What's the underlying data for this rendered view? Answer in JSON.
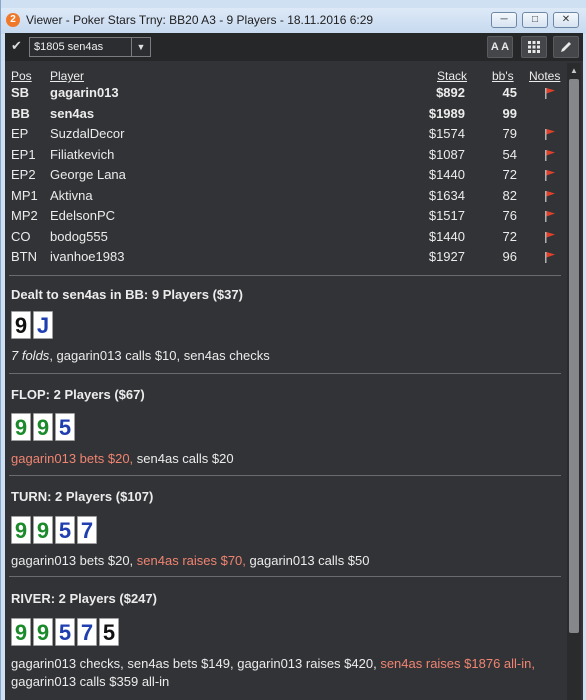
{
  "window": {
    "title": "Viewer - Poker Stars Trny: BB20 A3 - 9 Players - 18.11.2016 6:29",
    "app_icon_label": "2"
  },
  "toolbar": {
    "player_select": "$1805 sen4as",
    "font_button_label": "A A"
  },
  "table": {
    "headers": {
      "pos": "Pos",
      "player": "Player",
      "stack": "Stack",
      "bbs": "bb's",
      "notes": "Notes"
    },
    "rows": [
      {
        "pos": "SB",
        "player": "gagarin013",
        "stack": "$892",
        "bbs": "45",
        "bold": true,
        "flag": true
      },
      {
        "pos": "BB",
        "player": "sen4as",
        "stack": "$1989",
        "bbs": "99",
        "bold": true,
        "flag": false
      },
      {
        "pos": "EP",
        "player": "SuzdalDecor",
        "stack": "$1574",
        "bbs": "79",
        "bold": false,
        "flag": true
      },
      {
        "pos": "EP1",
        "player": "Filiatkevich",
        "stack": "$1087",
        "bbs": "54",
        "bold": false,
        "flag": true
      },
      {
        "pos": "EP2",
        "player": "George Lana",
        "stack": "$1440",
        "bbs": "72",
        "bold": false,
        "flag": true
      },
      {
        "pos": "MP1",
        "player": "Aktivna",
        "stack": "$1634",
        "bbs": "82",
        "bold": false,
        "flag": true
      },
      {
        "pos": "MP2",
        "player": "EdelsonPC",
        "stack": "$1517",
        "bbs": "76",
        "bold": false,
        "flag": true
      },
      {
        "pos": "CO",
        "player": "bodog555",
        "stack": "$1440",
        "bbs": "72",
        "bold": false,
        "flag": true
      },
      {
        "pos": "BTN",
        "player": "ivanhoe1983",
        "stack": "$1927",
        "bbs": "96",
        "bold": false,
        "flag": true
      }
    ]
  },
  "streets": [
    {
      "title": "Dealt to sen4as in BB: 9 Players ($37)",
      "cards": [
        {
          "rank": "9",
          "suit": "spade"
        },
        {
          "rank": "J",
          "suit": "diamond"
        }
      ],
      "action": [
        {
          "text": "7 folds",
          "style": "it"
        },
        {
          "text": ", gagarin013 calls $10, sen4as checks",
          "style": ""
        }
      ]
    },
    {
      "title": "FLOP: 2 Players ($67)",
      "cards": [
        {
          "rank": "9",
          "suit": "club"
        },
        {
          "rank": "9",
          "suit": "club"
        },
        {
          "rank": "5",
          "suit": "diamond"
        }
      ],
      "action": [
        {
          "text": "gagarin013 bets $20,",
          "style": "hl"
        },
        {
          "text": " sen4as calls $20",
          "style": ""
        }
      ]
    },
    {
      "title": "TURN: 2 Players ($107)",
      "cards": [
        {
          "rank": "9",
          "suit": "club"
        },
        {
          "rank": "9",
          "suit": "club"
        },
        {
          "rank": "5",
          "suit": "diamond"
        },
        {
          "rank": "7",
          "suit": "diamond"
        }
      ],
      "action": [
        {
          "text": "gagarin013 bets $20, ",
          "style": ""
        },
        {
          "text": "sen4as raises $70,",
          "style": "hl"
        },
        {
          "text": " gagarin013 calls $50",
          "style": ""
        }
      ]
    },
    {
      "title": "RIVER: 2 Players ($247)",
      "cards": [
        {
          "rank": "9",
          "suit": "club"
        },
        {
          "rank": "9",
          "suit": "club"
        },
        {
          "rank": "5",
          "suit": "diamond"
        },
        {
          "rank": "7",
          "suit": "diamond"
        },
        {
          "rank": "5",
          "suit": "spade"
        }
      ],
      "action": [
        {
          "text": "gagarin013 checks, sen4as bets $149, gagarin013 raises $420, ",
          "style": ""
        },
        {
          "text": "sen4as raises $1876 all-in,",
          "style": "hl"
        }
      ],
      "action2": "gagarin013 calls $359 all-in"
    }
  ],
  "colors": {
    "highlight": "#f08472",
    "flag": "#e0412b",
    "background": "#323336"
  }
}
